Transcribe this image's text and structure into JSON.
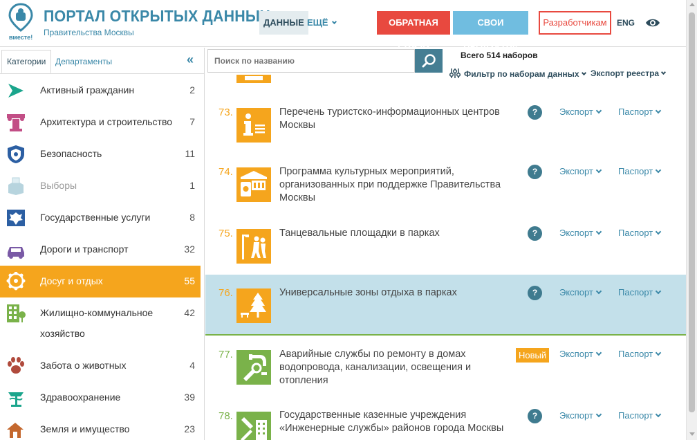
{
  "header": {
    "logo_text": "вместе!",
    "title": "ПОРТАЛ ОТКРЫТЫХ ДАННЫХ",
    "subtitle": "Правительства Москвы",
    "nav_data": "ДАННЫЕ",
    "nav_more": "ЕЩЁ",
    "btn_feedback": "ОБРАТНАЯ СВЯЗЬ",
    "btn_products": "СВОИ ПРОДУКТЫ!",
    "btn_dev": "Разработчикам",
    "lang": "ENG",
    "colors": {
      "brand": "#3a88a8",
      "red": "#e8493f",
      "light_blue": "#70bde0"
    }
  },
  "sidebar": {
    "tab_categories": "Категории",
    "tab_departments": "Департаменты",
    "collapse": "«",
    "items": [
      {
        "label": "Активный гражданин",
        "count": "2",
        "icon": "play-triangle-icon"
      },
      {
        "label": "Архитектура и строительство",
        "count": "7",
        "icon": "column-icon"
      },
      {
        "label": "Безопасность",
        "count": "11",
        "icon": "shield-icon"
      },
      {
        "label": "Выборы",
        "count": "1",
        "icon": "ballot-box-icon"
      },
      {
        "label": "Государственные услуги",
        "count": "8",
        "icon": "coat-of-arms-icon"
      },
      {
        "label": "Дороги и транспорт",
        "count": "32",
        "icon": "car-icon"
      },
      {
        "label": "Досуг и отдых",
        "count": "55",
        "icon": "ferris-wheel-icon"
      },
      {
        "label": "Жилищно-коммунальное хозяйство",
        "count": "42",
        "icon": "building-tree-icon"
      },
      {
        "label": "Забота о животных",
        "count": "4",
        "icon": "paw-icon"
      },
      {
        "label": "Здравоохранение",
        "count": "39",
        "icon": "health-snake-icon"
      },
      {
        "label": "Земля и имущество",
        "count": "23",
        "icon": "house-land-icon"
      }
    ],
    "active_color": "#f5a51d"
  },
  "search": {
    "placeholder": "Поиск по названию",
    "total": "Всего 514 наборов",
    "filter": "Фильтр по наборам данных",
    "registry": "Экспорт реестра"
  },
  "datasets": [
    {
      "num": "73.",
      "title": "Перечень туристско-информационных центров Москвы",
      "badge": "?",
      "export": "Экспорт",
      "passport": "Паспорт",
      "icon": "info-center-icon",
      "color": "#f5a51d"
    },
    {
      "num": "74.",
      "title": "Программа культурных мероприятий, организованных при поддержке Правительства Москвы",
      "badge": "?",
      "export": "Экспорт",
      "passport": "Паспорт",
      "icon": "museum-icon",
      "color": "#f5a51d"
    },
    {
      "num": "75.",
      "title": "Танцевальные площадки в парках",
      "badge": "?",
      "export": "Экспорт",
      "passport": "Паспорт",
      "icon": "dance-icon",
      "color": "#f5a51d"
    },
    {
      "num": "76.",
      "title": "Универсальные зоны отдыха в парках",
      "badge": "?",
      "export": "Экспорт",
      "passport": "Паспорт",
      "icon": "park-tree-icon",
      "color": "#f5a51d"
    },
    {
      "num": "77.",
      "title": "Аварийные службы по ремонту в домах водопровода, канализации, освещения и отопления",
      "badge": "Новый",
      "export": "Экспорт",
      "passport": "Паспорт",
      "icon": "repair-tools-icon",
      "color": "#7ab24a"
    },
    {
      "num": "78.",
      "title": "Государственные казенные учреждения «Инженерные службы» районов города Москвы",
      "badge": "?",
      "export": "Экспорт",
      "passport": "Паспорт",
      "icon": "engineering-icon",
      "color": "#7ab24a"
    }
  ]
}
